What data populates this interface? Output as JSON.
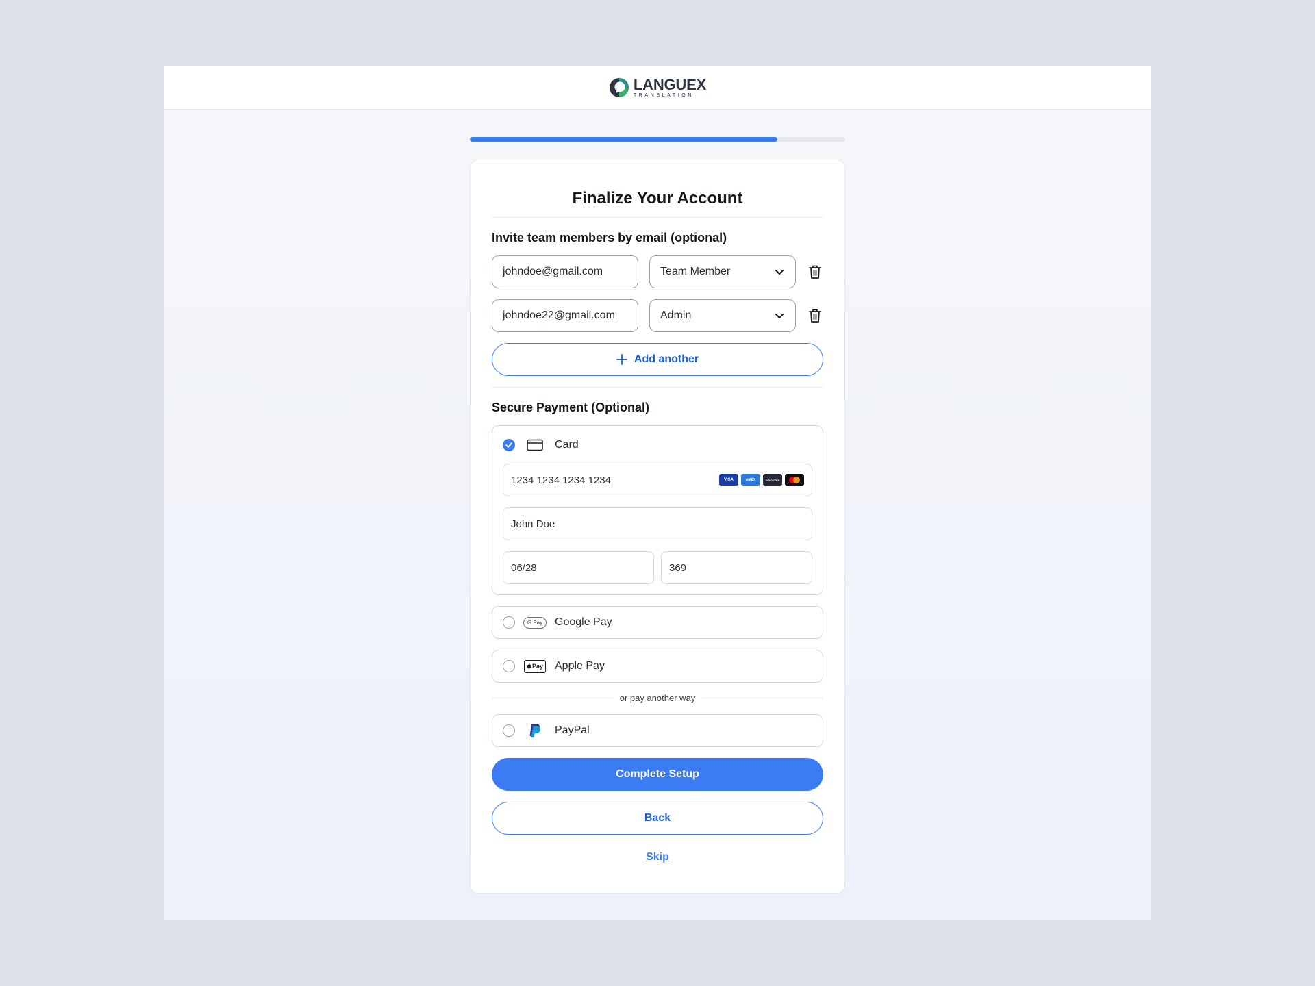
{
  "brand": {
    "name": "LANGUEX",
    "tagline": "TRANSLATION",
    "primary_color": "#3b7bf4",
    "logo_colors": [
      "#2f8f8a",
      "#3fae6a",
      "#2c3440"
    ]
  },
  "progress": {
    "fraction": 0.82
  },
  "page": {
    "title": "Finalize Your Account"
  },
  "invite": {
    "label": "Invite team members by email (optional)",
    "members": [
      {
        "email": "johndoe@gmail.com",
        "role": "Team Member"
      },
      {
        "email": "johndoe22@gmail.com",
        "role": "Admin"
      }
    ],
    "add_label": "Add another"
  },
  "payment": {
    "label": "Secure Payment (Optional)",
    "card": {
      "label": "Card",
      "selected": true,
      "number": "1234 1234 1234 1234",
      "name": "John Doe",
      "expiry": "06/28",
      "cvc": "369",
      "brands": [
        "VISA",
        "AMEX",
        "DISCOVER",
        "mastercard"
      ]
    },
    "google_pay": {
      "label": "Google Pay",
      "icon_text": "G Pay"
    },
    "apple_pay": {
      "label": "Apple Pay",
      "icon_text": "Pay"
    },
    "divider_text": "or pay another way",
    "paypal": {
      "label": "PayPal"
    }
  },
  "actions": {
    "complete": "Complete Setup",
    "back": "Back",
    "skip": "Skip"
  }
}
